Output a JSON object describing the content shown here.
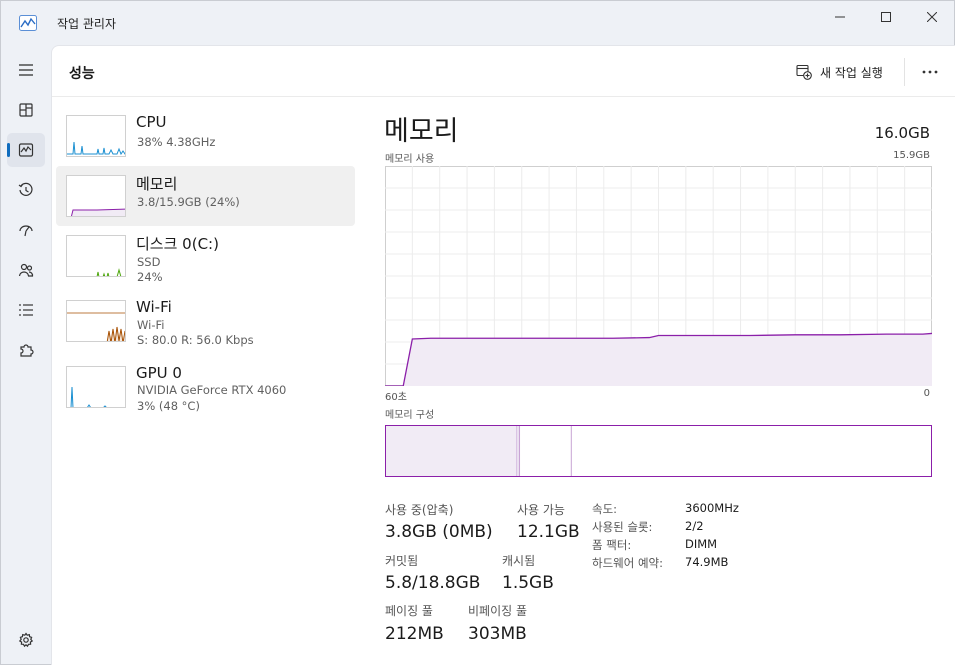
{
  "window": {
    "title": "작업 관리자"
  },
  "header": {
    "page_title": "성능",
    "run_task_label": "새 작업 실행"
  },
  "resources": [
    {
      "name": "CPU",
      "sub1": "38%  4.38GHz",
      "sub2": ""
    },
    {
      "name": "메모리",
      "sub1": "3.8/15.9GB (24%)",
      "sub2": ""
    },
    {
      "name": "디스크 0(C:)",
      "sub1": "SSD",
      "sub2": "24%"
    },
    {
      "name": "Wi-Fi",
      "sub1": "Wi-Fi",
      "sub2": "S: 80.0  R: 56.0 Kbps"
    },
    {
      "name": "GPU 0",
      "sub1": "NVIDIA GeForce RTX 4060",
      "sub2": "3%  (48 °C)"
    }
  ],
  "detail": {
    "title": "메모리",
    "total": "16.0GB",
    "usage_label": "메모리 사용",
    "usage_max": "15.9GB",
    "axis_left": "60초",
    "axis_right": "0",
    "composition_label": "메모리 구성",
    "composition": {
      "in_use": 0.24,
      "modified": 0.005,
      "standby": 0.095
    }
  },
  "stats": {
    "in_use_label": "사용 중(압축)",
    "in_use_value": "3.8GB (0MB)",
    "available_label": "사용 가능",
    "available_value": "12.1GB",
    "committed_label": "커밋됨",
    "committed_value": "5.8/18.8GB",
    "cached_label": "캐시됨",
    "cached_value": "1.5GB",
    "paged_label": "페이징 풀",
    "paged_value": "212MB",
    "nonpaged_label": "비페이징 풀",
    "nonpaged_value": "303MB"
  },
  "specs": [
    {
      "label": "속도:",
      "value": "3600MHz"
    },
    {
      "label": "사용된 슬롯:",
      "value": "2/2"
    },
    {
      "label": "폼 팩터:",
      "value": "DIMM"
    },
    {
      "label": "하드웨어 예약:",
      "value": "74.9MB"
    }
  ],
  "colors": {
    "accent": "#0f6cbd",
    "memory": "#8b1fa9",
    "memory_fill": "#f1ebf5",
    "cpu": "#1a8fd1",
    "disk": "#4da60c",
    "wifi": "#a74f01"
  },
  "chart_data": {
    "type": "area",
    "title": "메모리 사용",
    "xlabel": "",
    "ylabel": "",
    "ylim": [
      0,
      15.9
    ],
    "x": [
      60,
      58,
      57,
      55,
      50,
      45,
      40,
      35,
      31,
      30,
      25,
      20,
      15,
      10,
      5,
      1,
      0
    ],
    "values": [
      0,
      0,
      3.4,
      3.45,
      3.45,
      3.45,
      3.45,
      3.45,
      3.5,
      3.65,
      3.65,
      3.65,
      3.7,
      3.7,
      3.75,
      3.75,
      3.8
    ],
    "grid": true
  }
}
